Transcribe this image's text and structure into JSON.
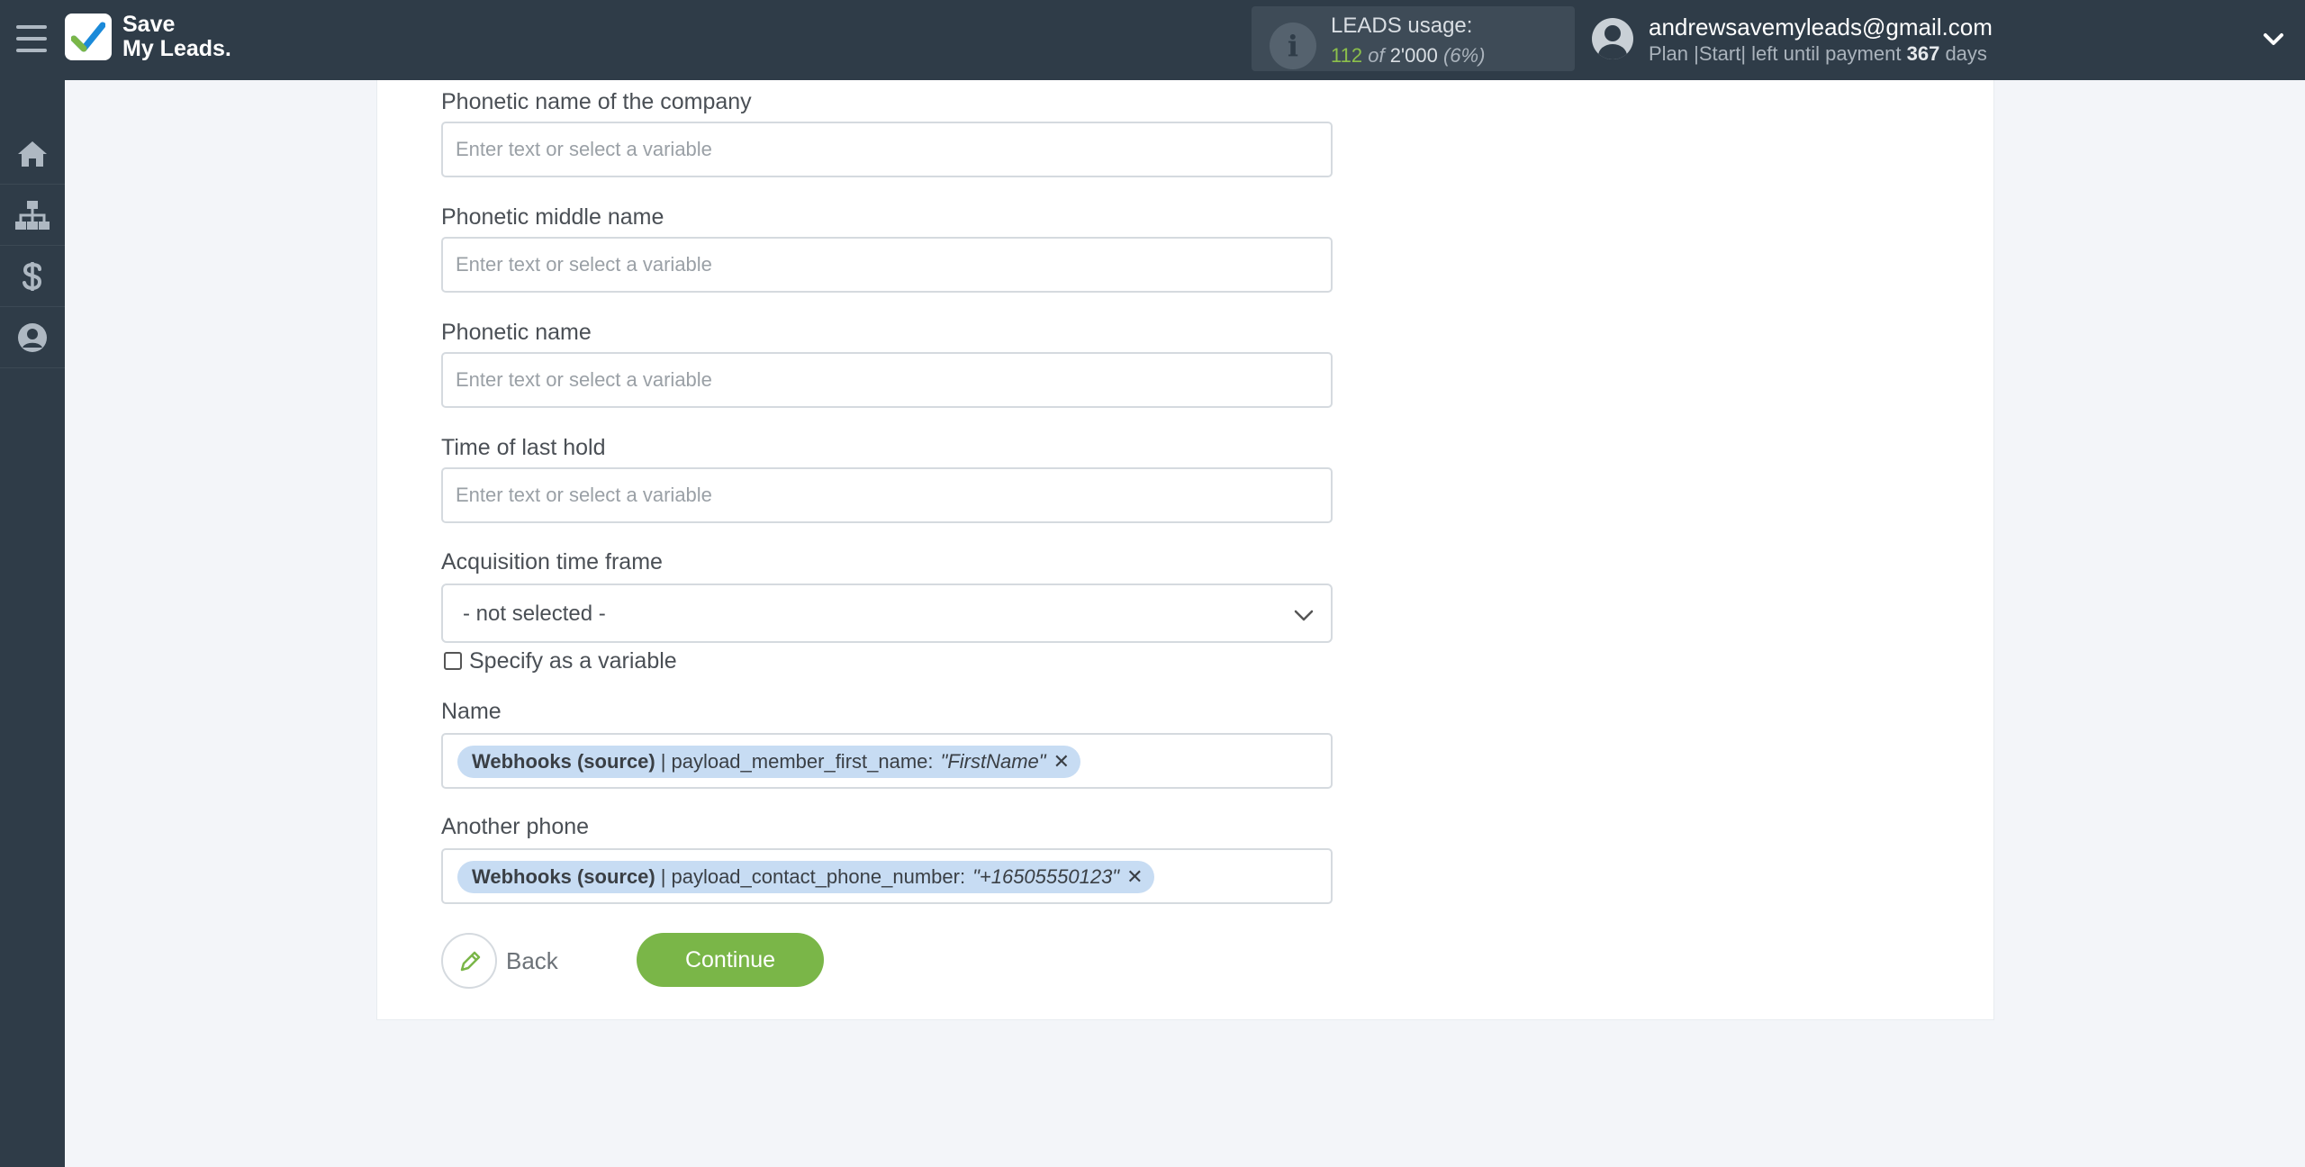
{
  "brand": {
    "line1": "Save",
    "line2": "My Leads."
  },
  "usage": {
    "label": "LEADS usage:",
    "used": "112",
    "of_word": "of",
    "total": "2'000",
    "percent": "(6%)"
  },
  "user": {
    "email": "andrewsavemyleads@gmail.com",
    "plan_prefix": "Plan |Start| left until payment",
    "days": "367",
    "days_suffix": "days"
  },
  "sidebar": {
    "items": [
      {
        "name": "home-icon"
      },
      {
        "name": "sitemap-icon"
      },
      {
        "name": "dollar-icon"
      },
      {
        "name": "account-icon"
      }
    ]
  },
  "form": {
    "fields": [
      {
        "label": "Phonetic name of the company",
        "placeholder": "Enter text or select a variable",
        "value": ""
      },
      {
        "label": "Phonetic middle name",
        "placeholder": "Enter text or select a variable",
        "value": ""
      },
      {
        "label": "Phonetic name",
        "placeholder": "Enter text or select a variable",
        "value": ""
      },
      {
        "label": "Time of last hold",
        "placeholder": "Enter text or select a variable",
        "value": ""
      }
    ],
    "acquisition": {
      "label": "Acquisition time frame",
      "selected": "- not selected -",
      "checkbox_label": "Specify as a variable"
    },
    "name_field": {
      "label": "Name",
      "tag_source": "Webhooks (source)",
      "tag_sep": "|",
      "tag_field": "payload_member_first_name:",
      "tag_value": "\"FirstName\""
    },
    "phone_field": {
      "label": "Another phone",
      "tag_source": "Webhooks (source)",
      "tag_sep": "|",
      "tag_field": "payload_contact_phone_number:",
      "tag_value": "\"+16505550123\""
    }
  },
  "actions": {
    "back_label": "Back",
    "continue_label": "Continue"
  },
  "colors": {
    "sidebar": "#2f3c48",
    "accent_green": "#7ab648",
    "tag_blue": "#c7dcf3"
  }
}
